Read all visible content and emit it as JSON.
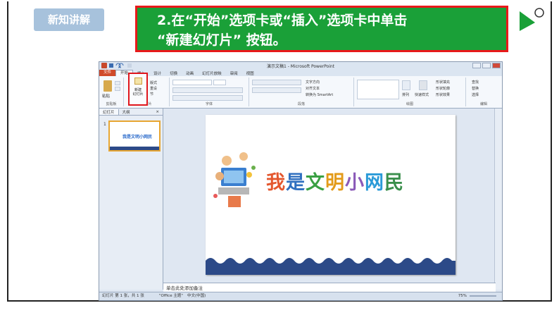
{
  "header": {
    "badge_label": "新知讲解",
    "instruction_line1": "2.在“开始”选项卡或“插入”选项卡中单击",
    "instruction_line2": "“新建幻灯片” 按钮。"
  },
  "ppt": {
    "window_title": "演示文稿1 - Microsoft PowerPoint",
    "tabs": [
      "文件",
      "开始",
      "插入",
      "设计",
      "切换",
      "动画",
      "幻灯片放映",
      "审阅",
      "视图"
    ],
    "ribbon": {
      "paste_label": "粘贴",
      "new_slide_label_line1": "新建",
      "new_slide_label_line2": "幻灯片",
      "layout_label": "版式",
      "reset_label": "重设",
      "section_label": "节",
      "text_direction": "文字方向",
      "align_text": "对齐文本",
      "convert_smartart": "转换为 SmartArt",
      "arrange_label": "排列",
      "quick_styles_label": "快速样式",
      "shape_fill": "形状填充",
      "shape_outline": "形状轮廓",
      "shape_effects": "形状效果",
      "find_label": "查找",
      "replace_label": "替换",
      "select_label": "选择",
      "groups": [
        "剪贴板",
        "幻灯片",
        "字体",
        "段落",
        "绘图",
        "编辑"
      ]
    },
    "left_pane": {
      "tab_slides": "幻灯片",
      "tab_outline": "大纲",
      "close_glyph": "×",
      "thumb_number": "1",
      "thumb_text": "我是文明小网民"
    },
    "slide": {
      "title_chars": [
        "我",
        "是",
        "文",
        "明",
        "小",
        "网",
        "民"
      ]
    },
    "notes_placeholder": "单击此处添加备注",
    "status": {
      "slide_info": "幻灯片 第 1 张，共 1 张",
      "theme": "\"Office 主题\"",
      "language": "中文(中国)",
      "zoom": "75%"
    }
  }
}
